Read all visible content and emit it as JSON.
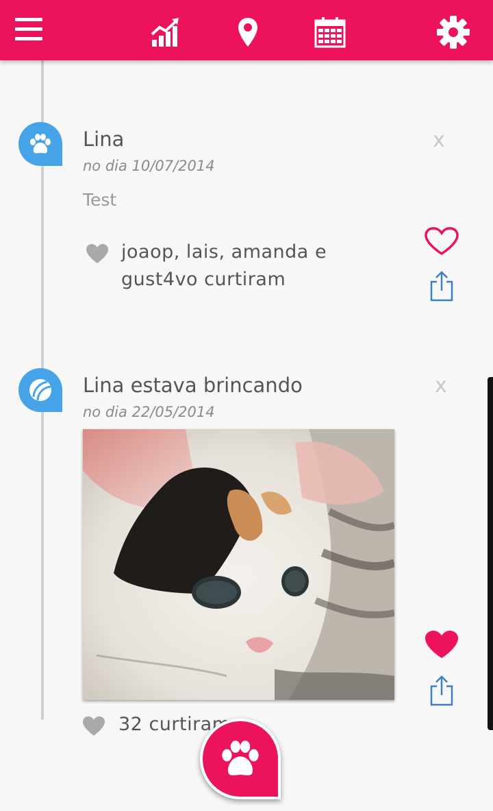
{
  "colors": {
    "accent": "#ec135a",
    "bubble_blue": "#47a3e8",
    "share_blue": "#3b7fc4",
    "background": "#f7f7f7"
  },
  "topbar": {
    "icons": [
      "menu-icon",
      "chart-icon",
      "location-pin-icon",
      "calendar-icon",
      "gear-icon"
    ]
  },
  "posts": [
    {
      "type_icon": "paw-icon",
      "title": "Lina",
      "date": "no dia 10/07/2014",
      "text": "Test",
      "close": "x",
      "likes_line1": "joaop, lais, amanda e",
      "likes_line2": "gust4vo curtiram",
      "liked": false
    },
    {
      "type_icon": "ball-icon",
      "title": "Lina estava brincando",
      "date": "no dia 22/05/2014",
      "close": "x",
      "likes": "32 curtiram",
      "liked": true
    }
  ],
  "fab": {
    "icon": "paw-icon"
  }
}
